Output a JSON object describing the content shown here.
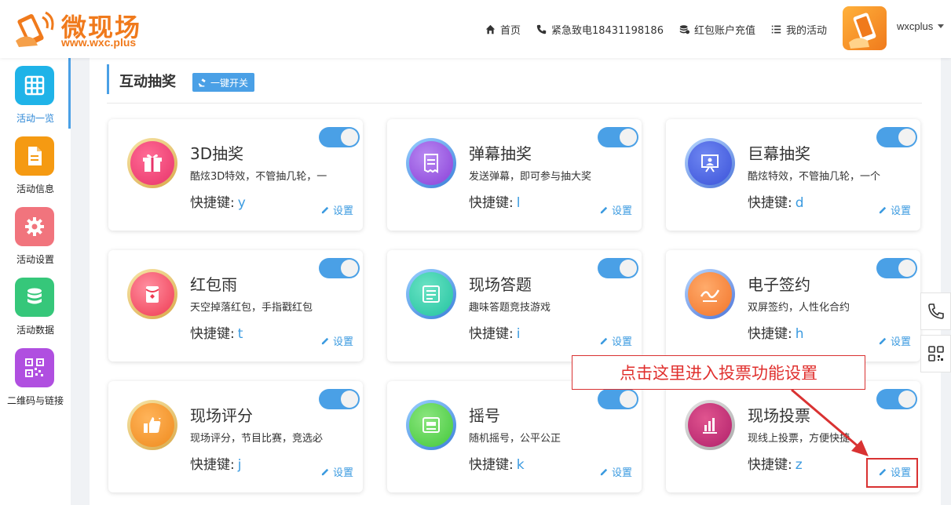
{
  "header": {
    "logo_title": "微现场",
    "logo_url": "www.wxc.plus",
    "nav": [
      {
        "label": "首页",
        "icon": "home-icon"
      },
      {
        "label": "紧急致电18431198186",
        "icon": "phone-icon"
      },
      {
        "label": "红包账户充值",
        "icon": "coins-icon"
      },
      {
        "label": "我的活动",
        "icon": "list-icon"
      }
    ],
    "username": "wxcplus"
  },
  "sidebar": {
    "items": [
      {
        "label": "活动一览",
        "icon": "grid-icon",
        "color": "#1fb3e8",
        "active": true
      },
      {
        "label": "活动信息",
        "icon": "document-icon",
        "color": "#f59a12",
        "active": false
      },
      {
        "label": "活动设置",
        "icon": "gear-icon",
        "color": "#f1747d",
        "active": false
      },
      {
        "label": "活动数据",
        "icon": "database-icon",
        "color": "#36c77a",
        "active": false
      },
      {
        "label": "二维码与链接",
        "icon": "qrcode-icon",
        "color": "#b04fe0",
        "active": false
      }
    ]
  },
  "section": {
    "title": "互动抽奖",
    "onekey_label": "一键开关"
  },
  "cards": [
    {
      "title": "3D抽奖",
      "desc": "酷炫3D特效，不管抽几轮，一",
      "key_label": "快捷键:",
      "key": "y",
      "settings_label": "设置",
      "icon": "gift-icon",
      "color": "#e8336a"
    },
    {
      "title": "弹幕抽奖",
      "desc": "发送弹幕，即可参与抽大奖",
      "key_label": "快捷键:",
      "key": "l",
      "settings_label": "设置",
      "icon": "receipt-icon",
      "color": "#8a3fd8"
    },
    {
      "title": "巨幕抽奖",
      "desc": "酷炫特效，不管抽几轮，一个",
      "key_label": "快捷键:",
      "key": "d",
      "settings_label": "设置",
      "icon": "presentation-icon",
      "color": "#3b52d9"
    },
    {
      "title": "红包雨",
      "desc": "天空掉落红包，手指戳红包",
      "key_label": "快捷键:",
      "key": "t",
      "settings_label": "设置",
      "icon": "red-packet-icon",
      "color": "#ef3a52"
    },
    {
      "title": "现场答题",
      "desc": "趣味答题竞技游戏",
      "key_label": "快捷键:",
      "key": "i",
      "settings_label": "设置",
      "icon": "quiz-icon",
      "color": "#22c3a0"
    },
    {
      "title": "电子签约",
      "desc": "双屏签约，人性化合约",
      "key_label": "快捷键:",
      "key": "h",
      "settings_label": "设置",
      "icon": "signature-icon",
      "color": "#f2742a"
    },
    {
      "title": "现场评分",
      "desc": "现场评分，节目比赛，竞选必",
      "key_label": "快捷键:",
      "key": "j",
      "settings_label": "设置",
      "icon": "thumbs-up-icon",
      "color": "#ef8a1d"
    },
    {
      "title": "摇号",
      "desc": "随机摇号，公平公正",
      "key_label": "快捷键:",
      "key": "k",
      "settings_label": "设置",
      "icon": "lottery-number-icon",
      "color": "#42c83a"
    },
    {
      "title": "现场投票",
      "desc": "现线上投票，方便快捷",
      "key_label": "快捷键:",
      "key": "z",
      "settings_label": "设置",
      "icon": "bar-chart-icon",
      "color": "#b0206a"
    }
  ],
  "annotation": {
    "text": "点击这里进入投票功能设置",
    "color": "#d93232"
  },
  "colors": {
    "accent": "#4aa0e6",
    "brand": "#f07a1c",
    "link": "#3c9be0"
  }
}
